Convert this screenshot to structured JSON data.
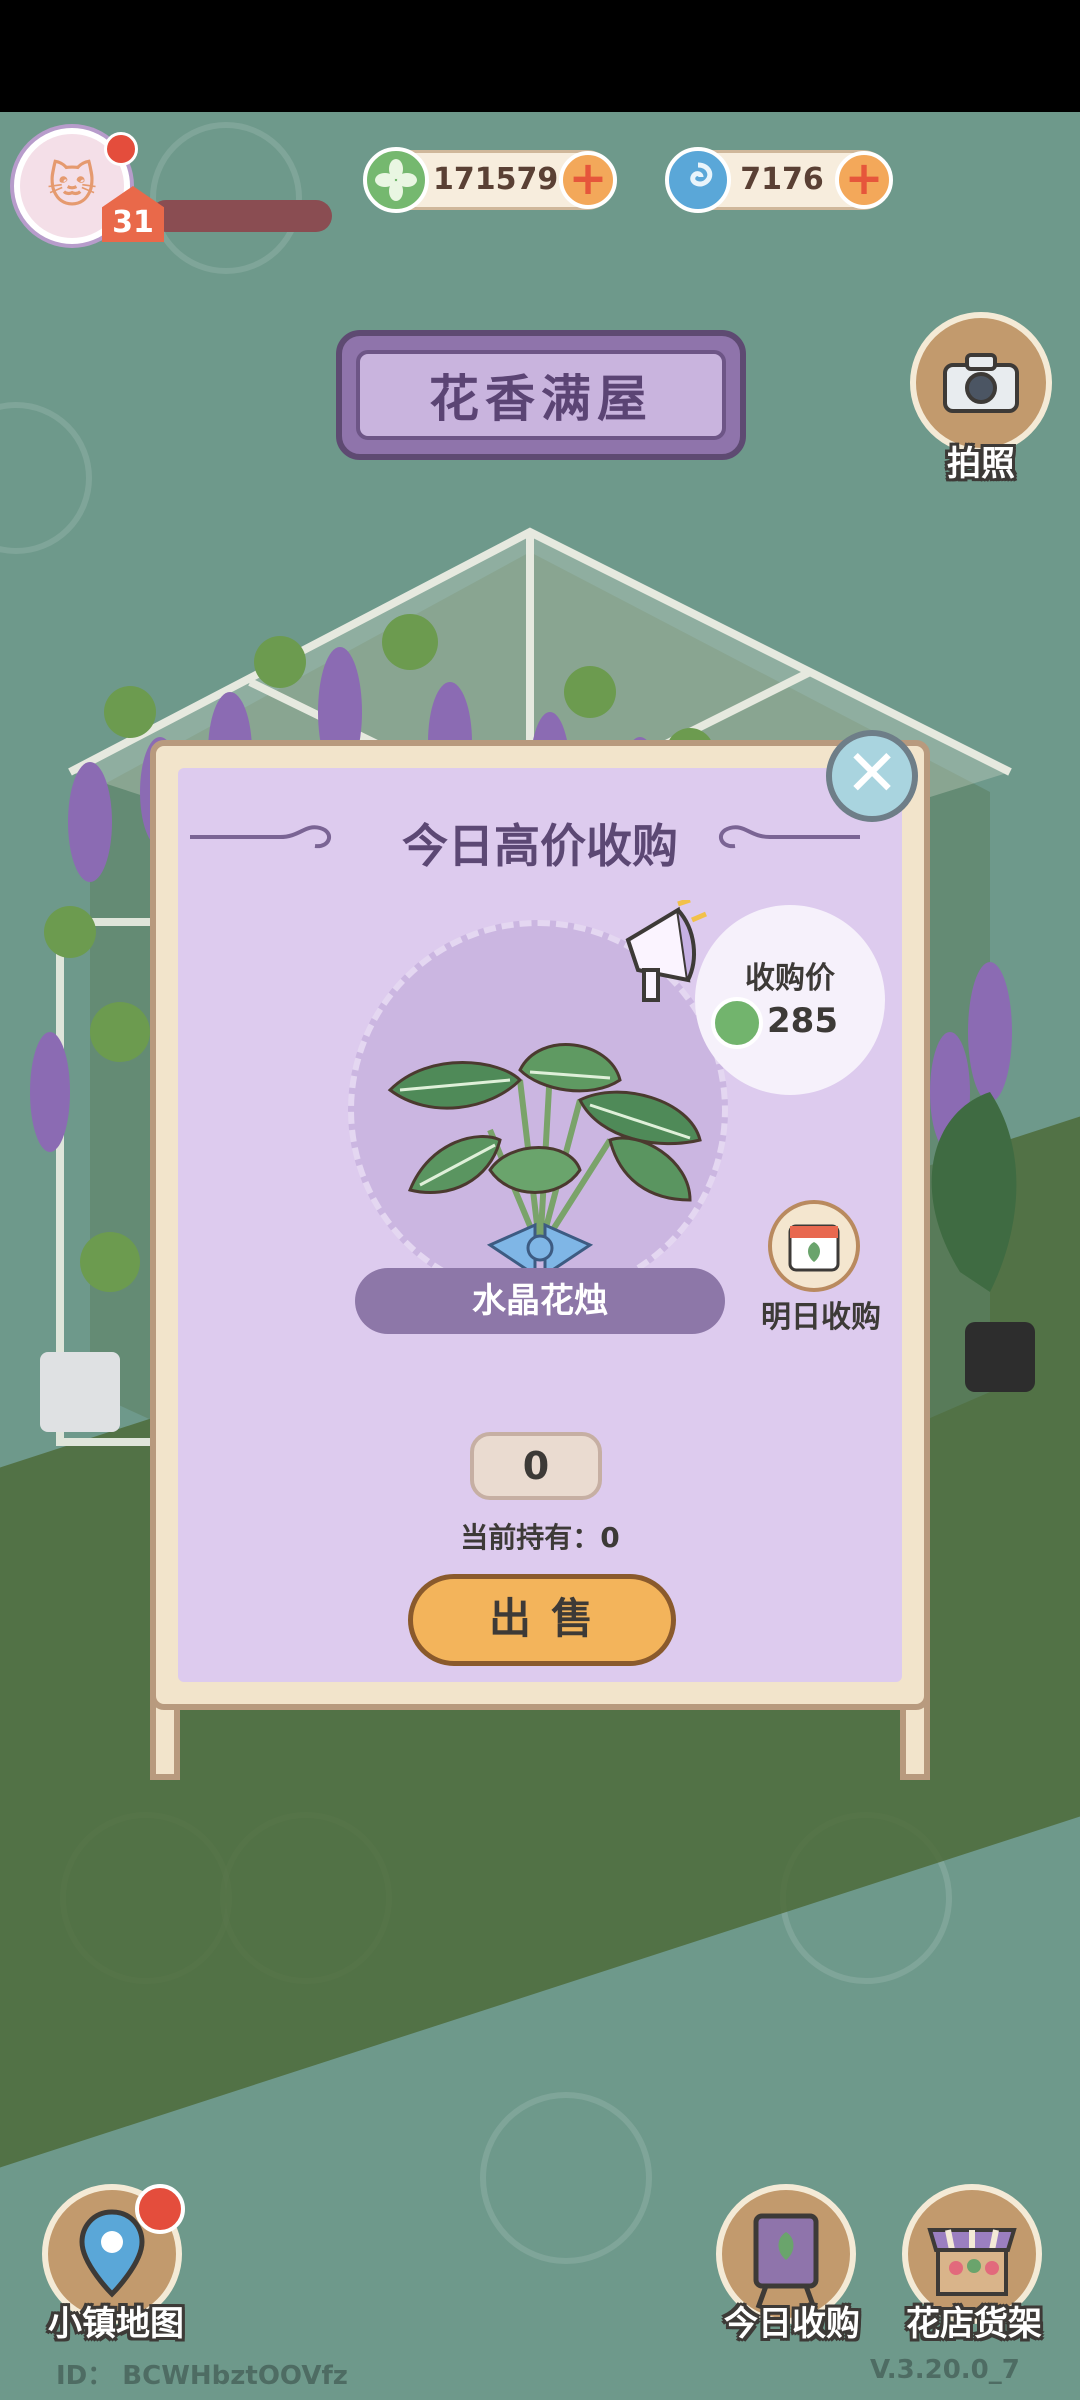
{
  "hud": {
    "level": "31",
    "currency_leaf": "171579",
    "currency_swirl": "7176",
    "plus_label": "+"
  },
  "location_title": "花香满屋",
  "camera_label": "拍照",
  "modal": {
    "title": "今日高价收购",
    "price_label": "收购价",
    "price": "285",
    "plant_name": "水晶花烛",
    "tomorrow_label": "明日收购",
    "quantity": "0",
    "held_text": "当前持有：0",
    "sell_label": "出售",
    "close_symbol": "✕"
  },
  "bottom": {
    "map_label": "小镇地图",
    "today_label": "今日收购",
    "shelf_label": "花店货架"
  },
  "footer": {
    "id_text": "ID： BCWHbztOOVfz",
    "version": "V.3.20.0_7"
  },
  "colors": {
    "background": "#6e998b",
    "panel": "#ddcbee",
    "sell_button": "#f3b45b",
    "title_text": "#5c4874"
  }
}
